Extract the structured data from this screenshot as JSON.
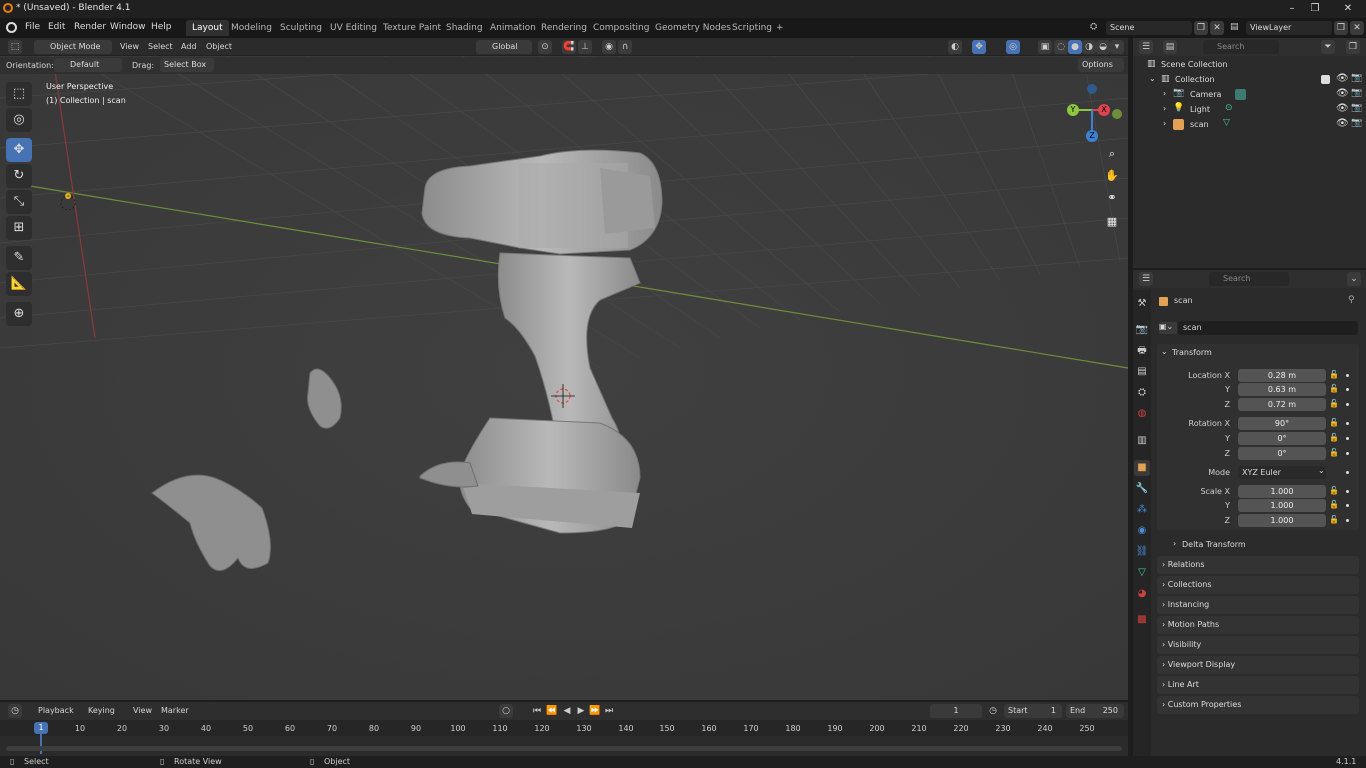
{
  "window": {
    "title": "* (Unsaved) - Blender 4.1"
  },
  "menu": [
    "File",
    "Edit",
    "Render",
    "Window",
    "Help"
  ],
  "workspaces": {
    "active": "Layout",
    "tabs": [
      "Layout",
      "Modeling",
      "Sculpting",
      "UV Editing",
      "Texture Paint",
      "Shading",
      "Animation",
      "Rendering",
      "Compositing",
      "Geometry Nodes",
      "Scripting"
    ],
    "add": "+"
  },
  "scene": {
    "name": "Scene",
    "view_layer": "ViewLayer"
  },
  "viewport_header": {
    "mode": "Object Mode",
    "menus": [
      "View",
      "Select",
      "Add",
      "Object"
    ],
    "transform_orientation": "Global"
  },
  "tool_options": {
    "orientation_label": "Orientation:",
    "orientation_value": "Default",
    "drag_label": "Drag:",
    "drag_value": "Select Box",
    "options": "Options"
  },
  "viewport_overlay": {
    "perspective": "User Perspective",
    "collection_info": "(1) Collection | scan"
  },
  "gizmo": {
    "x": "X",
    "y": "Y",
    "z": "Z"
  },
  "outliner": {
    "search_placeholder": "Search",
    "root": "Scene Collection",
    "collection": "Collection",
    "items": [
      {
        "name": "Camera"
      },
      {
        "name": "Light"
      },
      {
        "name": "scan"
      }
    ]
  },
  "properties": {
    "search_placeholder": "Search",
    "object_name": "scan",
    "data_name": "scan",
    "transform_title": "Transform",
    "location_label": "Location X",
    "location": [
      "0.28 m",
      "0.63 m",
      "0.72 m"
    ],
    "rotation_label": "Rotation X",
    "rotation": [
      "90°",
      "0°",
      "0°"
    ],
    "mode_label": "Mode",
    "mode_value": "XYZ Euler",
    "scale_label": "Scale X",
    "scale": [
      "1.000",
      "1.000",
      "1.000"
    ],
    "y_label": "Y",
    "z_label": "Z",
    "delta_transform": "Delta Transform",
    "panels": [
      "Relations",
      "Collections",
      "Instancing",
      "Motion Paths",
      "Visibility",
      "Viewport Display",
      "Line Art",
      "Custom Properties"
    ]
  },
  "timeline": {
    "menus": [
      "Playback",
      "Keying",
      "View",
      "Marker"
    ],
    "current_frame": "1",
    "start_label": "Start",
    "start": "1",
    "end_label": "End",
    "end": "250",
    "ticks": [
      "10",
      "20",
      "30",
      "40",
      "50",
      "60",
      "70",
      "80",
      "90",
      "100",
      "110",
      "120",
      "130",
      "140",
      "150",
      "160",
      "170",
      "180",
      "190",
      "200",
      "210",
      "220",
      "230",
      "240",
      "250"
    ]
  },
  "statusbar": {
    "select": "Select",
    "rotate": "Rotate View",
    "object": "Object",
    "version": "4.1.1"
  },
  "colors": {
    "accent": "#4772b3",
    "x_axis": "#e0424f",
    "y_axis": "#8dc63f",
    "z_axis": "#3b82d9"
  },
  "icons": [
    "blender-logo-icon",
    "search-icon",
    "eye-icon",
    "camera-icon",
    "light-icon",
    "mesh-icon",
    "play-icon"
  ]
}
